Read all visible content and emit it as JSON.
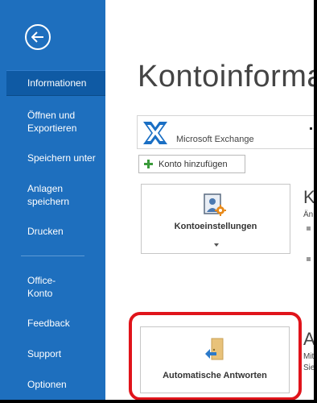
{
  "sidebar": {
    "back_label": "Zurück",
    "items": [
      {
        "label": "Informationen",
        "active": true
      },
      {
        "label": "Öffnen und Exportieren"
      },
      {
        "label": "Speichern unter"
      },
      {
        "label": "Anlagen speichern"
      },
      {
        "label": "Drucken"
      },
      {
        "label": "Office-Konto"
      },
      {
        "label": "Feedback"
      },
      {
        "label": "Support"
      },
      {
        "label": "Optionen"
      }
    ]
  },
  "main": {
    "title": "Kontoinformat",
    "account": {
      "name": "Microsoft Exchange"
    },
    "add_account_label": "Konto hinzufügen",
    "account_settings": {
      "button_label": "Kontoeinstellungen",
      "section_head": "Ko",
      "section_text": "Än"
    },
    "auto_reply": {
      "button_label": "Automatische Antworten",
      "section_head": "Au",
      "section_text_1": "Mit",
      "section_text_2": "Sie"
    }
  },
  "colors": {
    "sidebar": "#1e6fbe",
    "sidebar_active": "#0f5aa4",
    "highlight": "#e0141b"
  }
}
